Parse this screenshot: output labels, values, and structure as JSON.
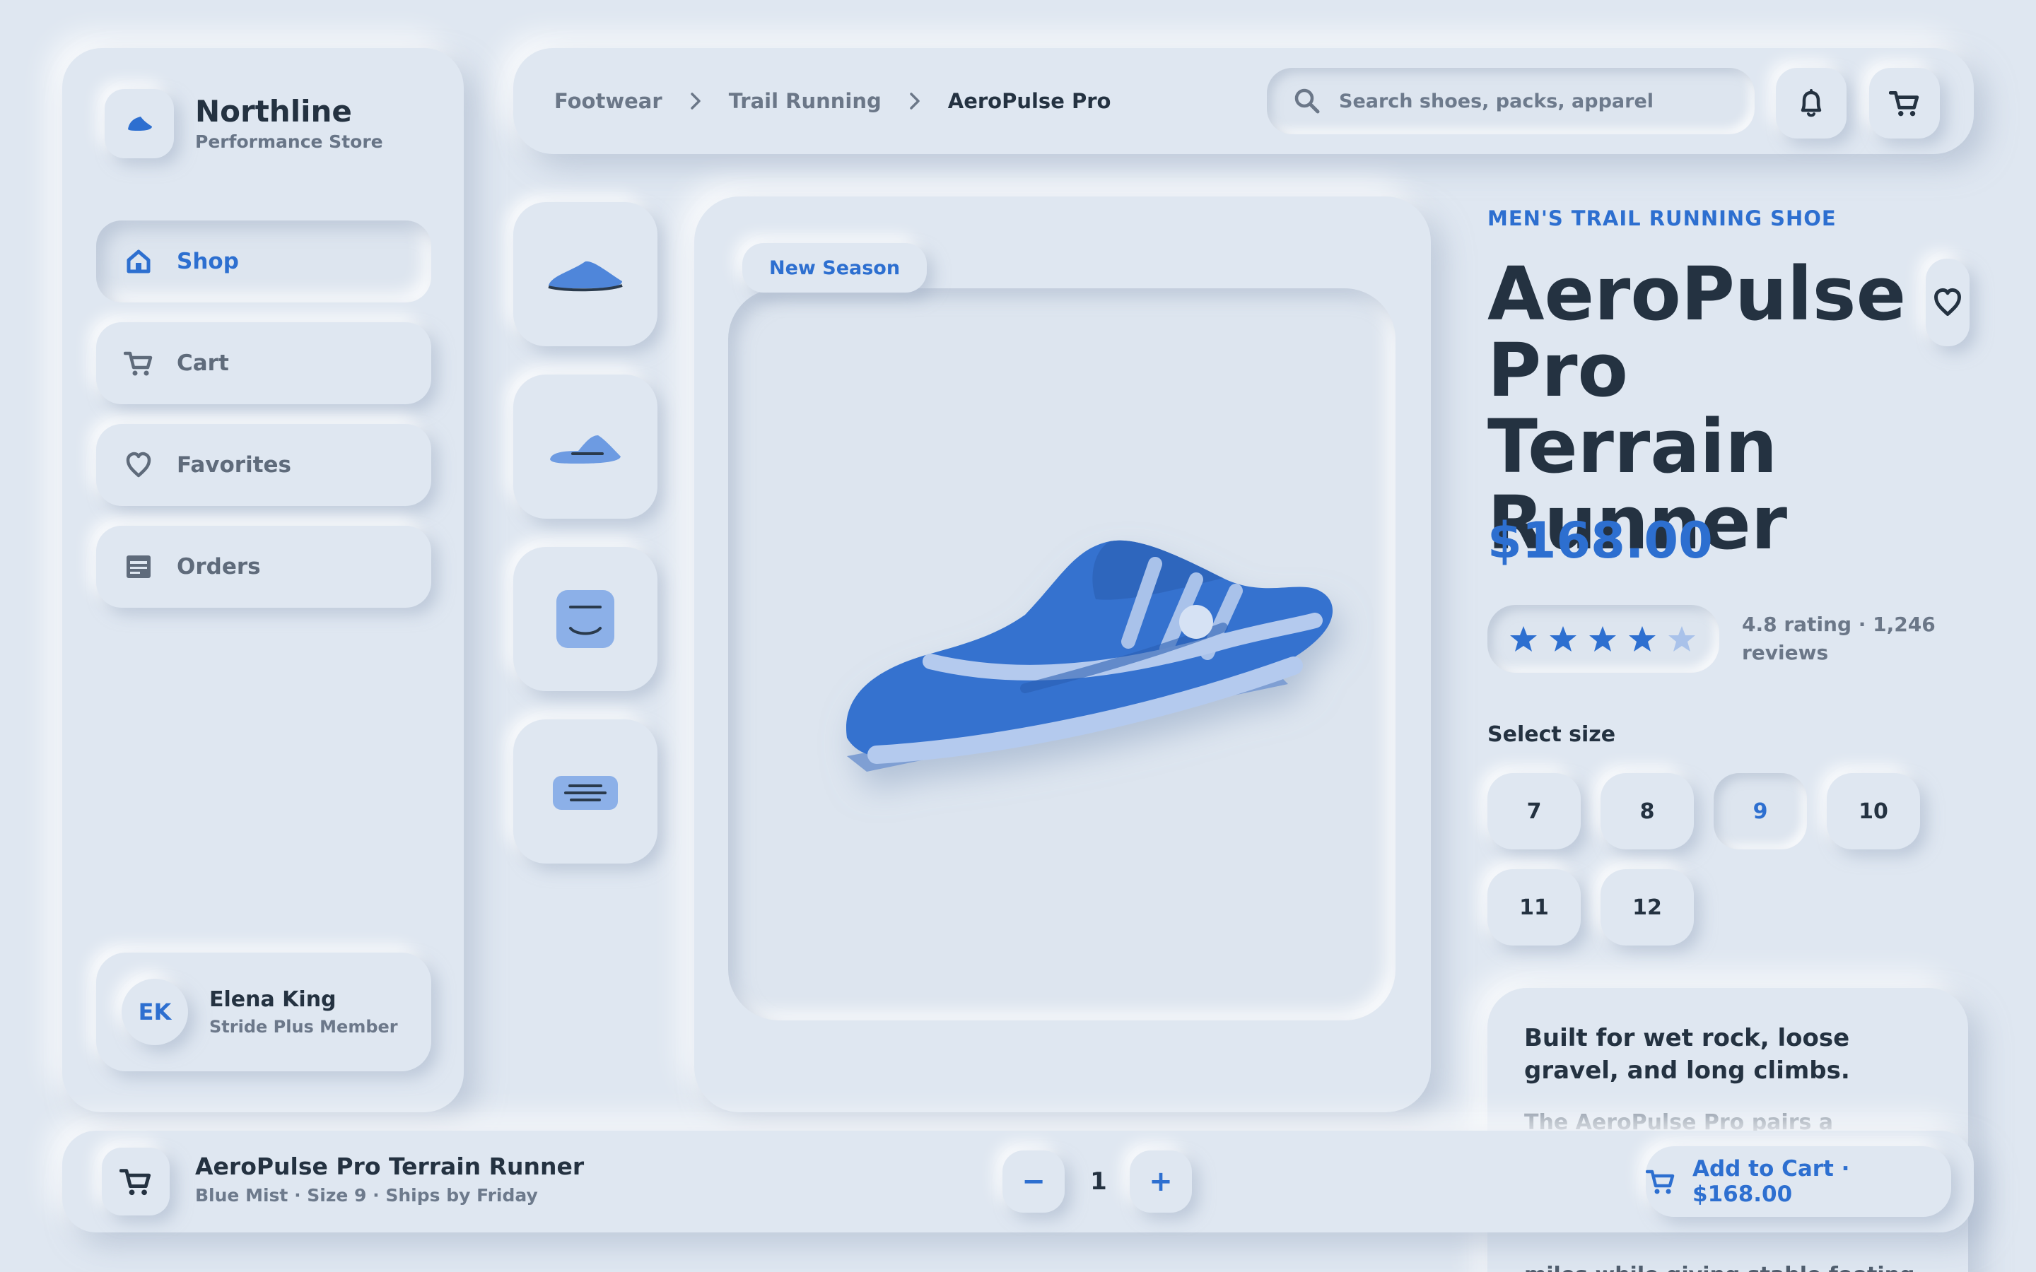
{
  "brand": {
    "name": "Northline",
    "subtitle": "Performance Store"
  },
  "sidebar": {
    "items": [
      {
        "label": "Shop",
        "icon": "home-icon",
        "active": true
      },
      {
        "label": "Cart",
        "icon": "cart-icon",
        "active": false
      },
      {
        "label": "Favorites",
        "icon": "heart-icon",
        "active": false
      },
      {
        "label": "Orders",
        "icon": "orders-icon",
        "active": false
      }
    ],
    "user": {
      "initials": "EK",
      "name": "Elena King",
      "role": "Stride Plus Member"
    }
  },
  "header": {
    "breadcrumb": [
      "Footwear",
      "Trail Running",
      "AeroPulse Pro"
    ],
    "search": {
      "placeholder": "Search shoes, packs, apparel",
      "value": ""
    },
    "icons": [
      "bell-icon",
      "cart-icon"
    ]
  },
  "gallery": {
    "badge": "New Season",
    "thumbnails": [
      "shoe-side-thumbnail",
      "shoe-top-thumbnail",
      "shoe-front-thumbnail",
      "shoe-sole-thumbnail"
    ]
  },
  "product": {
    "category": "MEN'S TRAIL RUNNING SHOE",
    "title": "AeroPulse Pro Terrain Runner",
    "price": "$168.00",
    "rating": 4.8,
    "rating_text": "4.8 rating · 1,246 reviews",
    "size_label": "Select size",
    "sizes": [
      "7",
      "8",
      "9",
      "10",
      "11",
      "12"
    ],
    "selected_size": "9",
    "description": {
      "headline": "Built for wet rock, loose gravel, and long climbs.",
      "body_visible_start": "The AeroPulse Pro pairs a cushioned",
      "body_visible_end": "miles while giving stable footing"
    }
  },
  "cartbar": {
    "title": "AeroPulse Pro Terrain Runner",
    "subtitle": "Blue Mist · Size 9 · Ships by Friday",
    "minus": "−",
    "quantity": "1",
    "plus": "+",
    "add_label": "Add to Cart · $168.00"
  },
  "colors": {
    "accent": "#2d6fd0",
    "background": "#dfe7f1",
    "text": "#243241",
    "muted": "#6b7788"
  }
}
